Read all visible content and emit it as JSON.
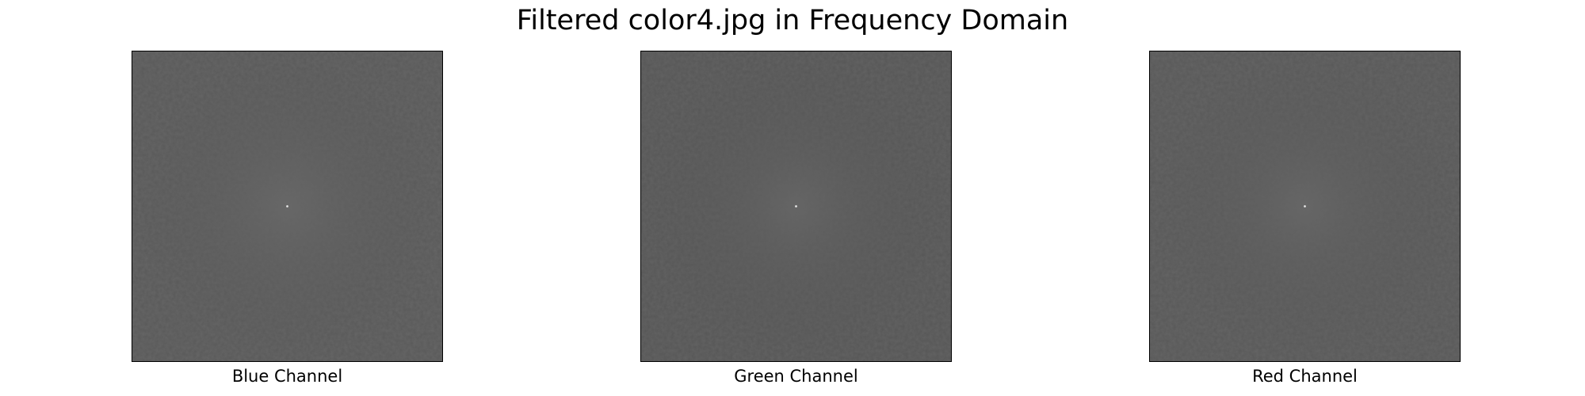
{
  "figure": {
    "title": "Filtered color4.jpg in Frequency Domain"
  },
  "panels": [
    {
      "label": "Blue Channel",
      "base_color": "#595959",
      "glow_color": "#686868",
      "dot_color": "#e6e6e6"
    },
    {
      "label": "Green Channel",
      "base_color": "#565656",
      "glow_color": "#666666",
      "dot_color": "#e6e6e6"
    },
    {
      "label": "Red Channel",
      "base_color": "#585858",
      "glow_color": "#676767",
      "dot_color": "#e6e6e6"
    }
  ]
}
